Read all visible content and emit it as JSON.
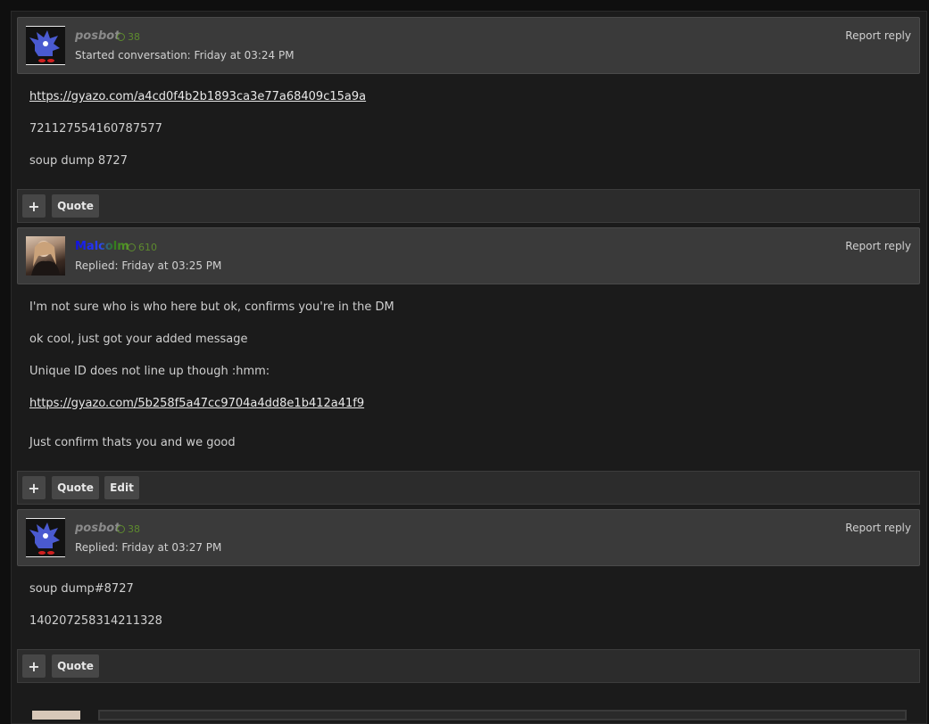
{
  "messages": [
    {
      "username": "posbot",
      "reputation": "38",
      "meta": "Started conversation: Friday at 03:24 PM",
      "report_label": "Report reply",
      "lines": [
        "https://gyazo.com/a4cd0f4b2b1893ca3e77a68409c15a9a",
        "721127554160787577",
        "soup dump 8727"
      ],
      "actions": {
        "plus": "+",
        "quote": "Quote"
      }
    },
    {
      "username": "Malcolm",
      "reputation": "610",
      "meta": "Replied: Friday at 03:25 PM",
      "report_label": "Report reply",
      "lines": [
        "I'm not sure who is who here but ok, confirms you're in the DM",
        "ok cool, just got your added message",
        "Unique ID does not line up though :hmm:",
        "https://gyazo.com/5b258f5a47cc9704a4dd8e1b412a41f9",
        "Just confirm thats you and we good"
      ],
      "actions": {
        "plus": "+",
        "quote": "Quote",
        "edit": "Edit"
      }
    },
    {
      "username": "posbot",
      "reputation": "38",
      "meta": "Replied: Friday at 03:27 PM",
      "report_label": "Report reply",
      "lines": [
        "soup dump#8727",
        "140207258314211328"
      ],
      "actions": {
        "plus": "+",
        "quote": "Quote"
      }
    }
  ],
  "colors": {
    "reputation": "#5d8a2e",
    "header_bg": "#3a3a3a",
    "page_bg": "#1b1b1b"
  }
}
